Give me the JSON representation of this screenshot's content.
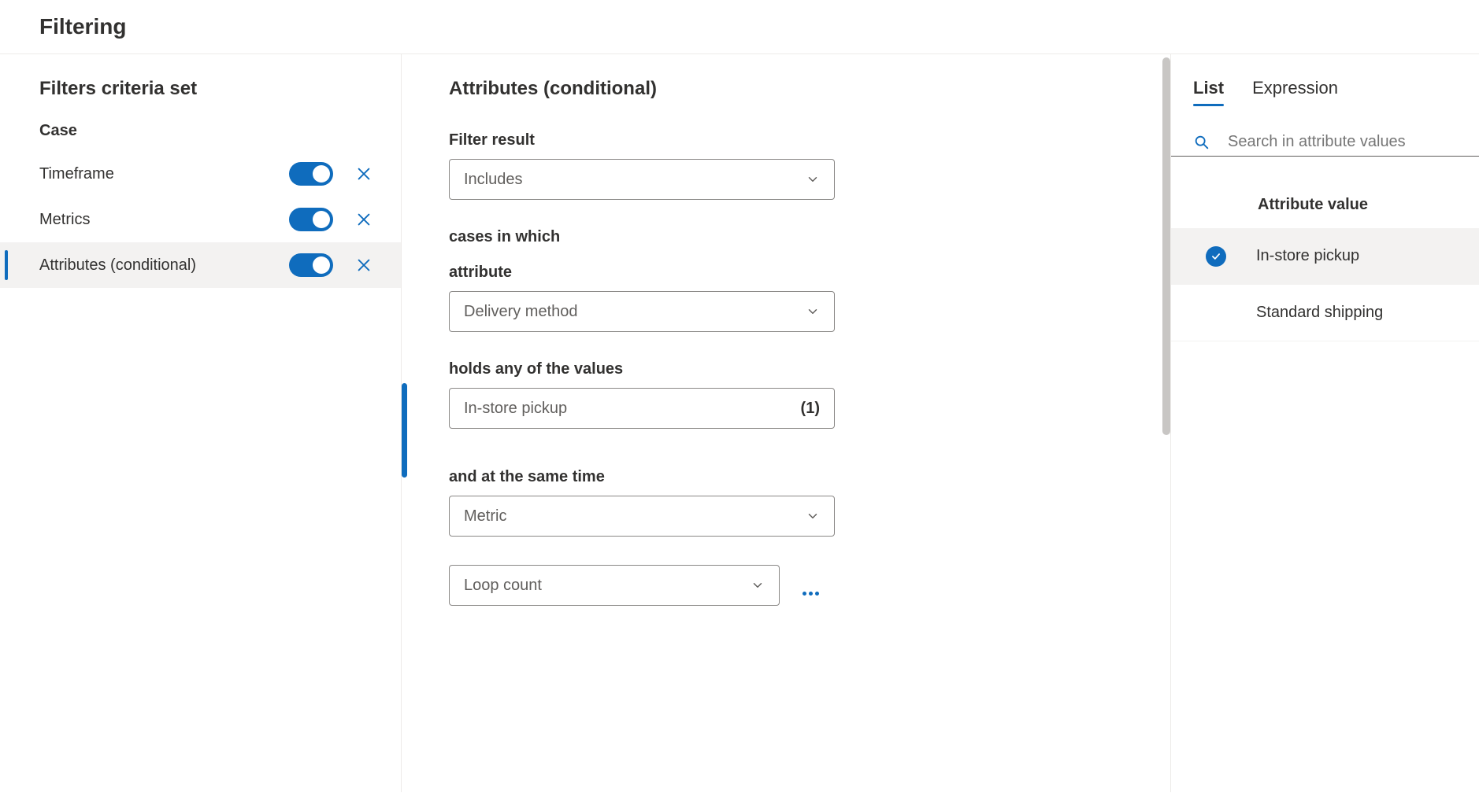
{
  "page_title": "Filtering",
  "left": {
    "heading": "Filters criteria set",
    "subheading": "Case",
    "items": [
      {
        "label": "Timeframe",
        "selected": false
      },
      {
        "label": "Metrics",
        "selected": false
      },
      {
        "label": "Attributes (conditional)",
        "selected": true
      }
    ]
  },
  "mid": {
    "heading": "Attributes (conditional)",
    "filter_result_label": "Filter result",
    "filter_result_value": "Includes",
    "cases_in_which_label": "cases in which",
    "attribute_label": "attribute",
    "attribute_value": "Delivery method",
    "holds_label": "holds any of the values",
    "holds_value_text": "In-store pickup",
    "holds_count": "(1)",
    "same_time_label": "and at the same time",
    "metric_label": "Metric",
    "loop_label": "Loop count"
  },
  "right": {
    "tabs": {
      "list": "List",
      "expression": "Expression"
    },
    "search_placeholder": "Search in attribute values",
    "heading": "Attribute value",
    "values": [
      {
        "label": "In-store pickup",
        "checked": true
      },
      {
        "label": "Standard shipping",
        "checked": false
      }
    ]
  }
}
